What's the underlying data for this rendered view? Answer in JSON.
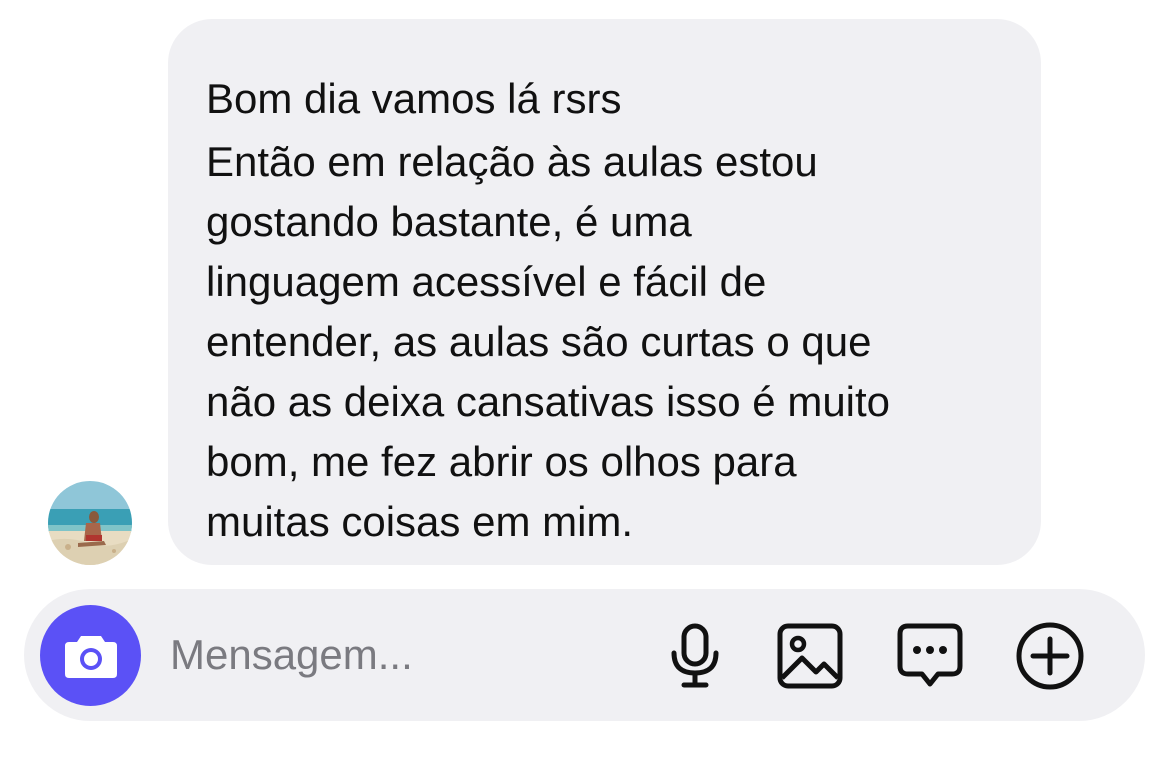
{
  "message": {
    "lines": [
      "Bom dia vamos lá rsrs",
      "Então em relação às aulas estou",
      "gostando bastante, é uma",
      "linguagem acessível e fácil de",
      "entender, as aulas são curtas o que",
      "não as deixa cansativas isso é muito",
      "bom, me fez abrir os olhos para",
      "muitas coisas em mim."
    ]
  },
  "composer": {
    "placeholder": "Mensagem...",
    "icons": {
      "camera": "camera-icon",
      "mic": "microphone-icon",
      "gallery": "image-icon",
      "sticker": "chat-bubble-icon",
      "add": "plus-circle-icon"
    }
  },
  "colors": {
    "accent": "#5b51f6",
    "bubble": "#f0f0f3",
    "text": "#111111",
    "placeholder": "#7a7a80"
  }
}
